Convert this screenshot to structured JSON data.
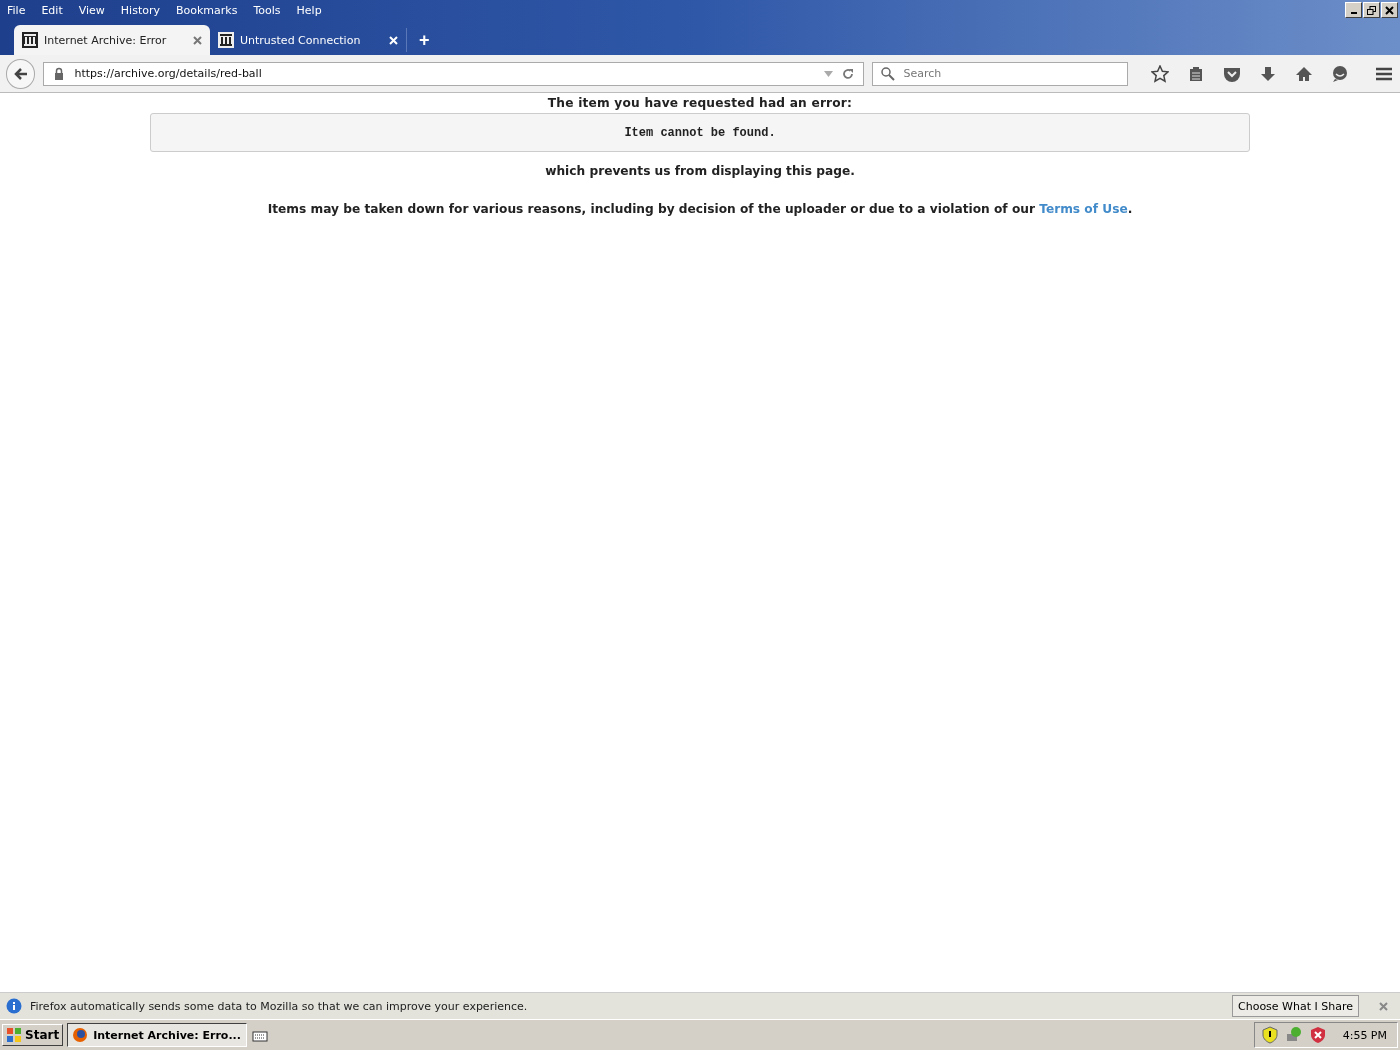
{
  "menu": [
    "File",
    "Edit",
    "View",
    "History",
    "Bookmarks",
    "Tools",
    "Help"
  ],
  "tabs": [
    {
      "title": "Internet Archive: Error",
      "selected": true
    },
    {
      "title": "Untrusted Connection",
      "selected": false
    }
  ],
  "new_tab": "+",
  "address": {
    "value": "https://archive.org/details/red-ball"
  },
  "search": {
    "placeholder": "Search"
  },
  "page": {
    "heading": "The item you have requested had an error:",
    "error": "Item cannot be found.",
    "after": "which prevents us from displaying this page.",
    "note": "Items may be taken down for various reasons, including by decision of the uploader or due to a violation of our",
    "link": "Terms of Use",
    "end": "."
  },
  "notification": {
    "text": "Firefox automatically sends some data to Mozilla so that we can improve your experience.",
    "button": "Choose What I Share"
  },
  "taskbar": {
    "start": "Start",
    "task": "Internet Archive: Erro...",
    "clock": "4:55 PM"
  }
}
